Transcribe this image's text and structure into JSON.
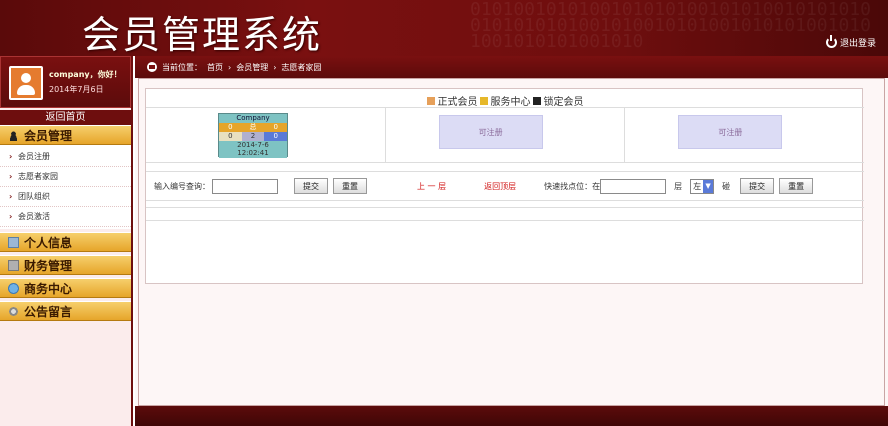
{
  "header": {
    "title": "会员管理系统",
    "logout_label": "退出登录"
  },
  "user": {
    "greeting": "company，你好！",
    "date": "2014年7月6日"
  },
  "sidebar": {
    "back_home": "返回首页",
    "sections": [
      {
        "label": "会员管理",
        "icon": "person-icon",
        "items": [
          "会员注册",
          "志愿者家园",
          "团队组织",
          "会员激活"
        ]
      },
      {
        "label": "个人信息",
        "icon": "document-icon"
      },
      {
        "label": "财务管理",
        "icon": "grid-icon"
      },
      {
        "label": "商务中心",
        "icon": "globe-icon"
      },
      {
        "label": "公告留言",
        "icon": "gear-icon"
      }
    ]
  },
  "breadcrumb": {
    "prefix": "当前位置：",
    "items": [
      "首页",
      "会员管理",
      "志愿者家园"
    ]
  },
  "legend": [
    {
      "label": "正式会员",
      "color": "#e6a05a"
    },
    {
      "label": "服务中心",
      "color": "#e6b82a"
    },
    {
      "label": "锁定会员",
      "color": "#222222"
    }
  ],
  "member_card": {
    "name": "Company",
    "row1": [
      "0",
      "总",
      "0"
    ],
    "row2": [
      "0",
      "2",
      "0"
    ],
    "date": "2014-7-6",
    "time": "12:02:41"
  },
  "register_slots": [
    "可注册",
    "可注册"
  ],
  "controls": {
    "search_label": "输入编号查询：",
    "search_value": "",
    "submit_label": "提交",
    "reset_label": "重置",
    "up_link": "上 一 层",
    "top_link": "返回顶层",
    "quick_label": "快速找点位：在",
    "quick_value": "",
    "layer_label": "层",
    "side_value": "左",
    "area_label": "碰",
    "submit2_label": "提交",
    "reset2_label": "重置"
  },
  "colors": {
    "brand": "#6e0e0e",
    "menu_gold": "#e6a52a"
  }
}
